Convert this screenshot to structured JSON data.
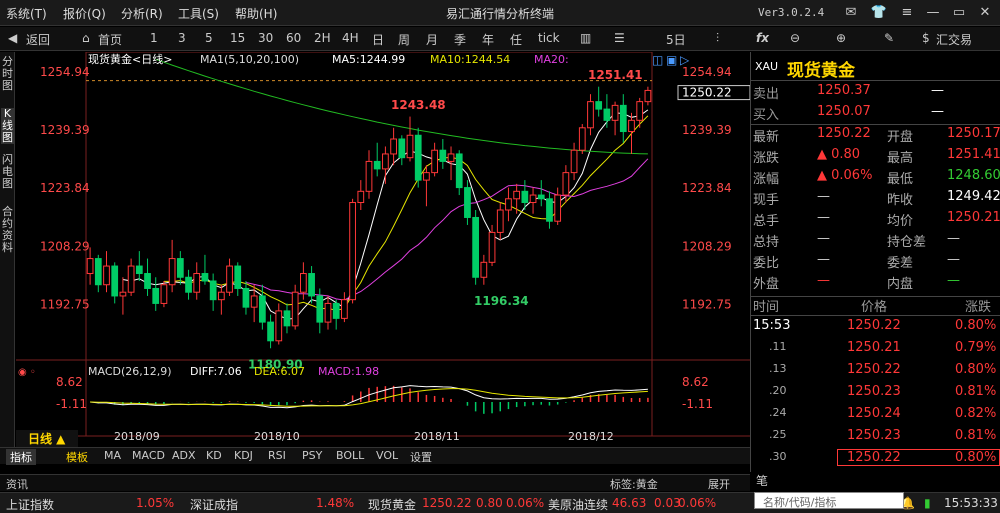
{
  "menubar": {
    "items": [
      "系统(T)",
      "报价(Q)",
      "分析(R)",
      "工具(S)",
      "帮助(H)"
    ],
    "title": "易汇通行情分析终端",
    "version": "Ver3.0.2.4"
  },
  "toolbar": {
    "back": "返回",
    "home": "首页",
    "periods": [
      "1",
      "3",
      "5",
      "15",
      "30",
      "60",
      "2H",
      "4H",
      "日",
      "周",
      "月",
      "季",
      "年",
      "任",
      "tick"
    ],
    "period5": "5日",
    "trade": "汇交易"
  },
  "lefttabs": [
    "分时图",
    "K线图",
    "闪电图",
    "合约资料"
  ],
  "chart": {
    "symbol": "现货黄金<日线>",
    "ma_label": "MA1(5,10,20,100)",
    "ma5": "MA5:1244.99",
    "ma10": "MA10:1244.54",
    "ma20": "MA20:",
    "price_ticks": [
      "1254.94",
      "1239.39",
      "1223.84",
      "1208.29",
      "1192.75"
    ],
    "current_price": "1250.22",
    "high_label": "1251.41",
    "peak_label": "1243.48",
    "low1_label": "1180.90",
    "low2_label": "1196.34",
    "macd_label": "MACD(26,12,9)",
    "diff": "DIFF:7.06",
    "dea": "DEA:6.07",
    "macd": "MACD:1.98",
    "macd_ticks": [
      "8.62",
      "-1.11"
    ],
    "dates": [
      "2018/09",
      "2018/10",
      "2018/11",
      "2018/12"
    ],
    "period_btn": "日线 ▲"
  },
  "chart_data": {
    "type": "candlestick",
    "title": "现货黄金<日线>",
    "ylim": [
      1180,
      1256
    ],
    "ma_periods": [
      5,
      10,
      20,
      100
    ],
    "ohlc": [
      [
        1201,
        1208,
        1198,
        1205
      ],
      [
        1205,
        1206,
        1196,
        1198
      ],
      [
        1198,
        1207,
        1196,
        1203
      ],
      [
        1203,
        1204,
        1193,
        1195
      ],
      [
        1195,
        1200,
        1190,
        1196
      ],
      [
        1196,
        1205,
        1195,
        1203
      ],
      [
        1203,
        1207,
        1199,
        1201
      ],
      [
        1201,
        1205,
        1195,
        1197
      ],
      [
        1197,
        1200,
        1191,
        1193
      ],
      [
        1193,
        1199,
        1192,
        1198
      ],
      [
        1198,
        1210,
        1196,
        1205
      ],
      [
        1205,
        1207,
        1198,
        1200
      ],
      [
        1200,
        1202,
        1194,
        1196
      ],
      [
        1196,
        1204,
        1194,
        1201
      ],
      [
        1201,
        1206,
        1198,
        1199
      ],
      [
        1199,
        1201,
        1191,
        1194
      ],
      [
        1194,
        1198,
        1190,
        1196
      ],
      [
        1196,
        1205,
        1195,
        1203
      ],
      [
        1203,
        1204,
        1195,
        1197
      ],
      [
        1197,
        1199,
        1190,
        1192
      ],
      [
        1192,
        1198,
        1188,
        1195
      ],
      [
        1195,
        1198,
        1186,
        1188
      ],
      [
        1188,
        1190,
        1181,
        1183
      ],
      [
        1183,
        1193,
        1182,
        1191
      ],
      [
        1191,
        1193,
        1185,
        1187
      ],
      [
        1187,
        1198,
        1186,
        1196
      ],
      [
        1196,
        1204,
        1194,
        1201
      ],
      [
        1201,
        1203,
        1193,
        1195
      ],
      [
        1195,
        1197,
        1185,
        1188
      ],
      [
        1188,
        1195,
        1186,
        1193
      ],
      [
        1193,
        1194,
        1186,
        1189
      ],
      [
        1189,
        1196,
        1188,
        1194
      ],
      [
        1194,
        1221,
        1193,
        1220
      ],
      [
        1220,
        1226,
        1218,
        1223
      ],
      [
        1223,
        1234,
        1221,
        1231
      ],
      [
        1231,
        1236,
        1227,
        1229
      ],
      [
        1229,
        1235,
        1225,
        1233
      ],
      [
        1233,
        1240,
        1230,
        1237
      ],
      [
        1237,
        1238,
        1230,
        1232
      ],
      [
        1232,
        1243,
        1231,
        1238
      ],
      [
        1238,
        1240,
        1224,
        1226
      ],
      [
        1226,
        1230,
        1219,
        1228
      ],
      [
        1228,
        1236,
        1227,
        1234
      ],
      [
        1234,
        1237,
        1229,
        1231
      ],
      [
        1231,
        1235,
        1226,
        1233
      ],
      [
        1233,
        1234,
        1222,
        1224
      ],
      [
        1224,
        1226,
        1214,
        1216
      ],
      [
        1216,
        1218,
        1198,
        1200
      ],
      [
        1200,
        1206,
        1198,
        1204
      ],
      [
        1204,
        1214,
        1203,
        1212
      ],
      [
        1212,
        1220,
        1210,
        1218
      ],
      [
        1218,
        1224,
        1215,
        1221
      ],
      [
        1221,
        1225,
        1217,
        1223
      ],
      [
        1223,
        1226,
        1218,
        1220
      ],
      [
        1220,
        1224,
        1217,
        1222
      ],
      [
        1222,
        1226,
        1219,
        1221
      ],
      [
        1221,
        1223,
        1213,
        1215
      ],
      [
        1215,
        1224,
        1214,
        1222
      ],
      [
        1222,
        1230,
        1220,
        1228
      ],
      [
        1228,
        1236,
        1226,
        1234
      ],
      [
        1234,
        1241,
        1233,
        1240
      ],
      [
        1240,
        1249,
        1238,
        1247
      ],
      [
        1247,
        1251,
        1243,
        1245
      ],
      [
        1245,
        1249,
        1240,
        1242
      ],
      [
        1242,
        1247,
        1238,
        1246
      ],
      [
        1246,
        1249,
        1236,
        1239
      ],
      [
        1239,
        1244,
        1233,
        1242
      ],
      [
        1242,
        1248,
        1240,
        1247
      ],
      [
        1247,
        1251,
        1246,
        1250
      ]
    ],
    "macd_diff_last": 7.06,
    "macd_dea_last": 6.07,
    "macd_last": 1.98
  },
  "quote": {
    "code": "XAU",
    "name": "现货黄金",
    "sell_label": "卖出",
    "sell": "1250.37",
    "sell_vol": "—",
    "buy_label": "买入",
    "buy": "1250.07",
    "buy_vol": "—",
    "rows": [
      [
        "最新",
        "1250.22",
        "开盘",
        "1250.17"
      ],
      [
        "涨跌",
        "▲ 0.80",
        "最高",
        "1251.41"
      ],
      [
        "涨幅",
        "▲ 0.06%",
        "最低",
        "1248.60"
      ],
      [
        "现手",
        "—",
        "昨收",
        "1249.42"
      ],
      [
        "总手",
        "—",
        "均价",
        "1250.21"
      ],
      [
        "总持",
        "—",
        "持仓差",
        "—"
      ],
      [
        "委比",
        "—",
        "委差",
        "—"
      ],
      [
        "外盘",
        "—",
        "内盘",
        "—"
      ]
    ],
    "tick_header": [
      "时间",
      "价格",
      "涨跌"
    ],
    "ticks": [
      [
        "15:53",
        "1250.22",
        "0.80%"
      ],
      [
        ".11",
        "1250.21",
        "0.79%"
      ],
      [
        ".13",
        "1250.22",
        "0.80%"
      ],
      [
        ".20",
        "1250.23",
        "0.81%"
      ],
      [
        ".24",
        "1250.24",
        "0.82%"
      ],
      [
        ".25",
        "1250.23",
        "0.81%"
      ],
      [
        ".30",
        "1250.22",
        "0.80%"
      ]
    ],
    "search_placeholder": "名称/代码/指标",
    "bi": "笔"
  },
  "bottomtabs": [
    "指标",
    "模板",
    "MA",
    "MACD",
    "ADX",
    "KD",
    "KDJ",
    "RSI",
    "PSY",
    "BOLL",
    "VOL",
    "设置"
  ],
  "zixun": {
    "label": "资讯",
    "tag": "标签:黄金",
    "expand": "展开"
  },
  "ticker": [
    [
      "上证指数",
      "1.05%"
    ],
    [
      "深证成指",
      "1.48%"
    ],
    [
      "现货黄金",
      "1250.22",
      "0.80",
      "0.06%"
    ],
    [
      "美原油连续",
      "46.63",
      "0.03",
      "0.06%"
    ]
  ],
  "clock": "15:53:33"
}
